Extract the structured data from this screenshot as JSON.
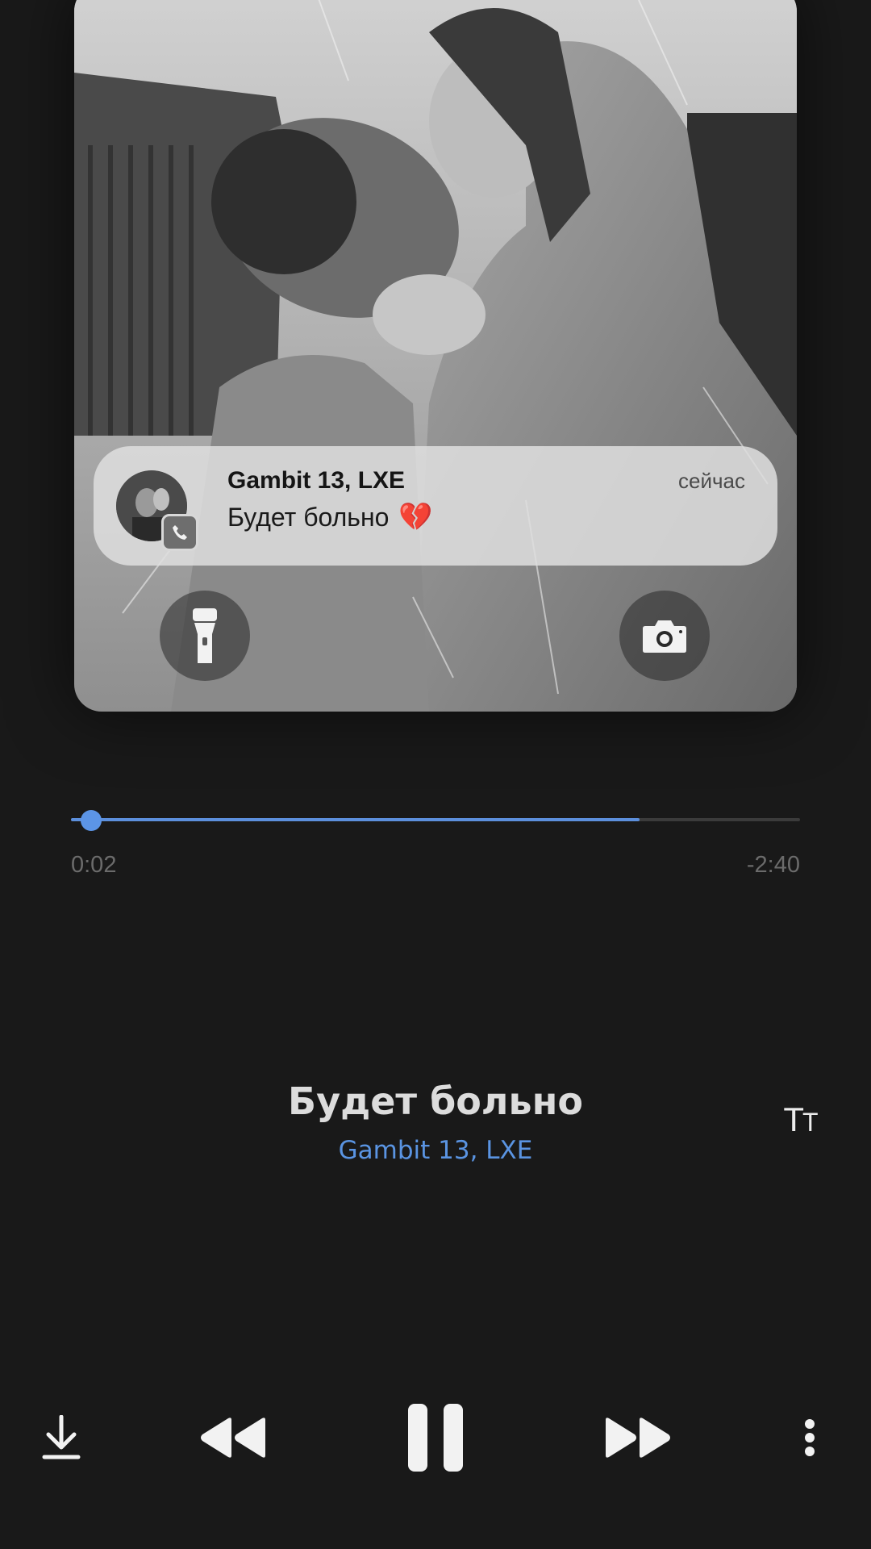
{
  "notification": {
    "title": "Gambit 13, LXE",
    "text": "Будет больно",
    "emoji": "💔",
    "time": "сейчас"
  },
  "lockscreen": {
    "left_icon": "flashlight-icon",
    "right_icon": "camera-icon"
  },
  "player": {
    "progress_fraction": 0.013,
    "buffered_fraction": 0.78,
    "elapsed": "0:02",
    "remaining": "-2:40",
    "track_title": "Будет больно",
    "artist": "Gambit 13, LXE",
    "lyrics_icon": "text-size-icon",
    "controls": [
      "download-icon",
      "rewind-icon",
      "pause-icon",
      "fast-forward-icon",
      "more-vertical-icon"
    ]
  },
  "colors": {
    "background": "#191919",
    "accent": "#5c95e6"
  }
}
